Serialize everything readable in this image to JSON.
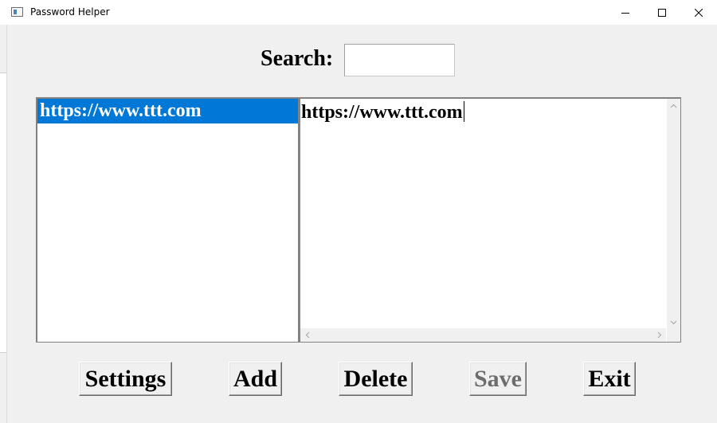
{
  "window": {
    "title": "Password Helper",
    "controls": {
      "minimize": "minimize-icon",
      "maximize": "maximize-icon",
      "close": "close-icon"
    }
  },
  "search": {
    "label": "Search:",
    "value": "",
    "placeholder": ""
  },
  "site_list": {
    "items": [
      {
        "label": "https://www.ttt.com",
        "selected": true
      }
    ]
  },
  "detail": {
    "text": "https://www.ttt.com"
  },
  "buttons": {
    "settings": "Settings",
    "add": "Add",
    "delete": "Delete",
    "save": "Save",
    "exit": "Exit",
    "save_enabled": false
  },
  "colors": {
    "selection": "#0078d7",
    "window_bg": "#f0f0f0",
    "disabled_text": "#6d6d6d"
  }
}
